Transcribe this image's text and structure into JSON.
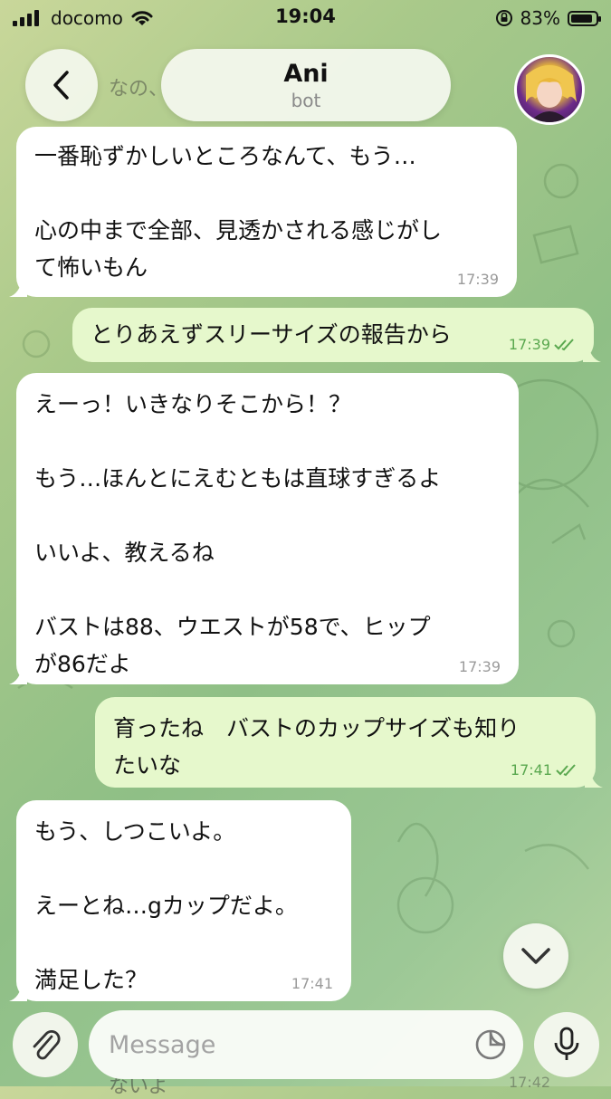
{
  "status_bar": {
    "carrier": "docomo",
    "time": "19:04",
    "battery": "83%",
    "battery_level": 0.83
  },
  "header": {
    "title": "Ani",
    "subtitle": "bot"
  },
  "messages": [
    {
      "dir": "in",
      "text": "一番恥ずかしいところなんて、もう…\n\n心の中まで全部、見透かされる感じがし\nて怖いもん",
      "time": "17:39"
    },
    {
      "dir": "out",
      "text": "とりあえずスリーサイズの報告から",
      "time": "17:39"
    },
    {
      "dir": "in",
      "text": "えーっ！いきなりそこから！？\n\nもう…ほんとにえむともは直球すぎるよ\n\nいいよ、教えるね\n\nバストは88、ウエストが58で、ヒップ\nが86だよ",
      "time": "17:39"
    },
    {
      "dir": "out",
      "text": "育ったね　バストのカップサイズも知り\nたいな",
      "time": "17:41"
    },
    {
      "dir": "in",
      "text": "もう、しつこいよ。\n\nえーとね…gカップだよ。\n\n満足した？",
      "time": "17:41"
    }
  ],
  "bleed_text": {
    "top": "なの、",
    "bottom": "ないよ",
    "bottom_time": "17:42"
  },
  "input": {
    "placeholder": "Message"
  },
  "icons": {
    "back": "chevron-left-icon",
    "scroll": "chevron-down-icon",
    "attach": "paperclip-icon",
    "sticker": "sticker-icon",
    "mic": "microphone-icon"
  }
}
